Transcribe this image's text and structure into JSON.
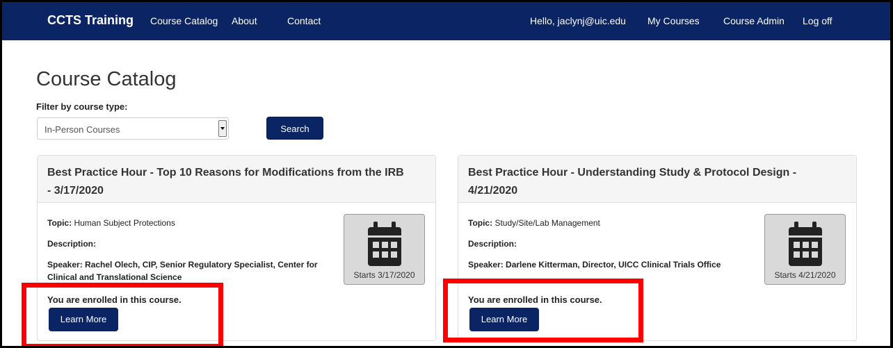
{
  "navbar": {
    "brand": "CCTS Training",
    "links": [
      "Course Catalog",
      "About",
      "Contact"
    ],
    "greeting": "Hello, jaclynj@uic.edu",
    "right_links": [
      "My Courses",
      "Course Admin",
      "Log off"
    ]
  },
  "page": {
    "title": "Course Catalog",
    "filter_label": "Filter by course type:",
    "filter_value": "In-Person Courses",
    "search_label": "Search"
  },
  "courses": [
    {
      "title": "Best Practice Hour - Top 10 Reasons for Modifications from the IRB - 3/17/2020",
      "topic_label": "Topic:",
      "topic": "Human Subject Protections",
      "description_label": "Description:",
      "speaker": "Speaker: Rachel Olech, CIP, Senior Regulatory Specialist, Center for Clinical and Translational Science",
      "starts": "Starts 3/17/2020",
      "enrolled": "You are enrolled in this course.",
      "learn_more": "Learn More"
    },
    {
      "title": "Best Practice Hour - Understanding Study & Protocol Design - 4/21/2020",
      "topic_label": "Topic:",
      "topic": "Study/Site/Lab Management",
      "description_label": "Description:",
      "speaker": "Speaker: Darlene Kitterman, Director, UICC Clinical Trials Office",
      "starts": "Starts 4/21/2020",
      "enrolled": "You are enrolled in this course.",
      "learn_more": "Learn More"
    }
  ],
  "colors": {
    "navbar": "#0b2464",
    "highlight": "#ff0000"
  }
}
